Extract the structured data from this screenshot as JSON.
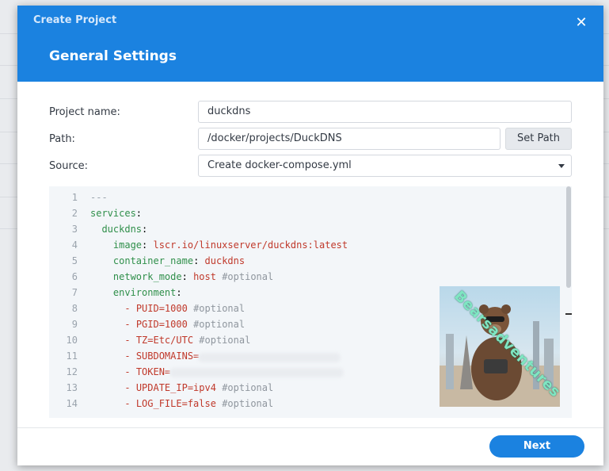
{
  "dialog": {
    "title": "Create Project",
    "subtitle": "General Settings",
    "close_glyph": "✕"
  },
  "form": {
    "project_name_label": "Project name:",
    "project_name_value": "duckdns",
    "path_label": "Path:",
    "path_value": "/docker/projects/DuckDNS",
    "set_path_label": "Set Path",
    "source_label": "Source:",
    "source_value": "Create docker-compose.yml"
  },
  "editor": {
    "lines": [
      {
        "n": "1",
        "indent": "",
        "key": "",
        "sep": "---",
        "val": "",
        "comment": ""
      },
      {
        "n": "2",
        "indent": "",
        "key": "services",
        "sep": ":",
        "val": "",
        "comment": ""
      },
      {
        "n": "3",
        "indent": "  ",
        "key": "duckdns",
        "sep": ":",
        "val": "",
        "comment": ""
      },
      {
        "n": "4",
        "indent": "    ",
        "key": "image",
        "sep": ": ",
        "val": "lscr.io/linuxserver/duckdns:latest",
        "comment": ""
      },
      {
        "n": "5",
        "indent": "    ",
        "key": "container_name",
        "sep": ": ",
        "val": "duckdns",
        "comment": ""
      },
      {
        "n": "6",
        "indent": "    ",
        "key": "network_mode",
        "sep": ": ",
        "val": "host",
        "comment": " #optional"
      },
      {
        "n": "7",
        "indent": "    ",
        "key": "environment",
        "sep": ":",
        "val": "",
        "comment": ""
      },
      {
        "n": "8",
        "indent": "      ",
        "key": "",
        "sep": "- ",
        "val": "PUID=1000",
        "comment": " #optional"
      },
      {
        "n": "9",
        "indent": "      ",
        "key": "",
        "sep": "- ",
        "val": "PGID=1000",
        "comment": " #optional"
      },
      {
        "n": "10",
        "indent": "      ",
        "key": "",
        "sep": "- ",
        "val": "TZ=Etc/UTC",
        "comment": " #optional"
      },
      {
        "n": "11",
        "indent": "      ",
        "key": "",
        "sep": "- ",
        "val": "SUBDOMAINS=",
        "comment": ""
      },
      {
        "n": "12",
        "indent": "      ",
        "key": "",
        "sep": "- ",
        "val": "TOKEN=",
        "comment": ""
      },
      {
        "n": "13",
        "indent": "      ",
        "key": "",
        "sep": "- ",
        "val": "UPDATE_IP=ipv4",
        "comment": " #optional"
      },
      {
        "n": "14",
        "indent": "      ",
        "key": "",
        "sep": "- ",
        "val": "LOG_FILE=false",
        "comment": " #optional"
      }
    ]
  },
  "watermark": {
    "text": "Bearsadventures"
  },
  "footer": {
    "next_label": "Next"
  },
  "colors": {
    "accent": "#1b82e0",
    "yaml_key": "#2f8f4a",
    "yaml_value": "#c0392b",
    "yaml_comment": "#8f969e"
  }
}
